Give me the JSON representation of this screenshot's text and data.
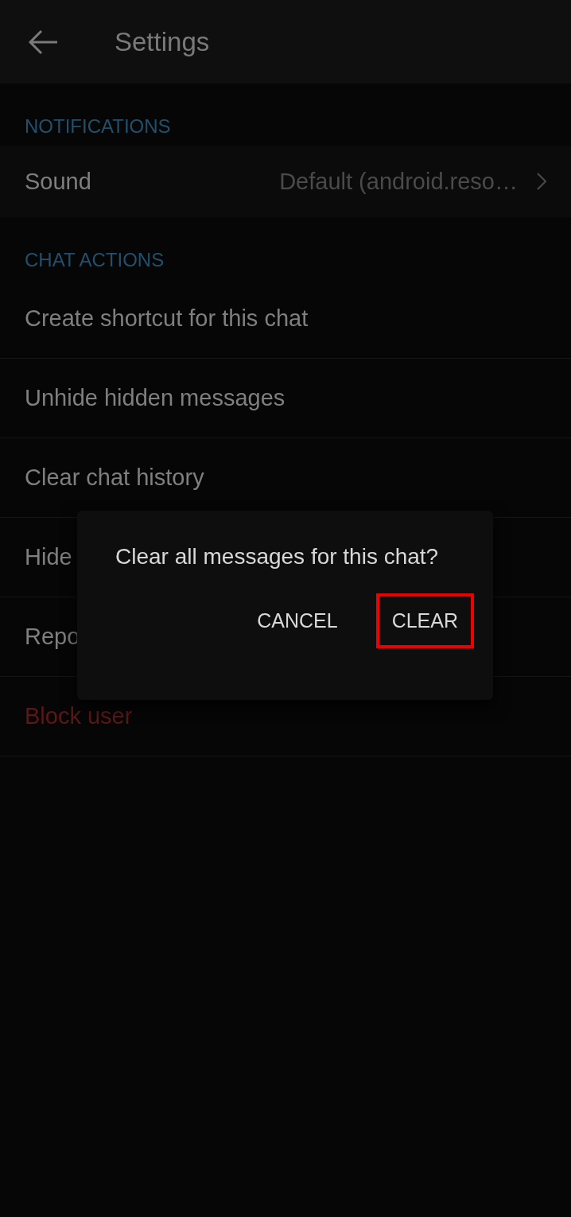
{
  "app_bar": {
    "title": "Settings"
  },
  "sections": [
    {
      "header": "NOTIFICATIONS",
      "rows": [
        {
          "kind": "value",
          "label": "Sound",
          "value": "Default (android.reso…"
        }
      ]
    },
    {
      "header": "CHAT ACTIONS",
      "rows": [
        {
          "kind": "action",
          "label": "Create shortcut for this chat"
        },
        {
          "kind": "action",
          "label": "Unhide hidden messages"
        },
        {
          "kind": "action",
          "label": "Clear chat history"
        },
        {
          "kind": "action",
          "label": "Hide"
        },
        {
          "kind": "action",
          "label": "Repo"
        },
        {
          "kind": "danger",
          "label": "Block user"
        }
      ]
    }
  ],
  "dialog": {
    "message": "Clear all messages for this chat?",
    "buttons": [
      {
        "label": "CANCEL",
        "highlighted": false
      },
      {
        "label": "CLEAR",
        "highlighted": true
      }
    ]
  }
}
